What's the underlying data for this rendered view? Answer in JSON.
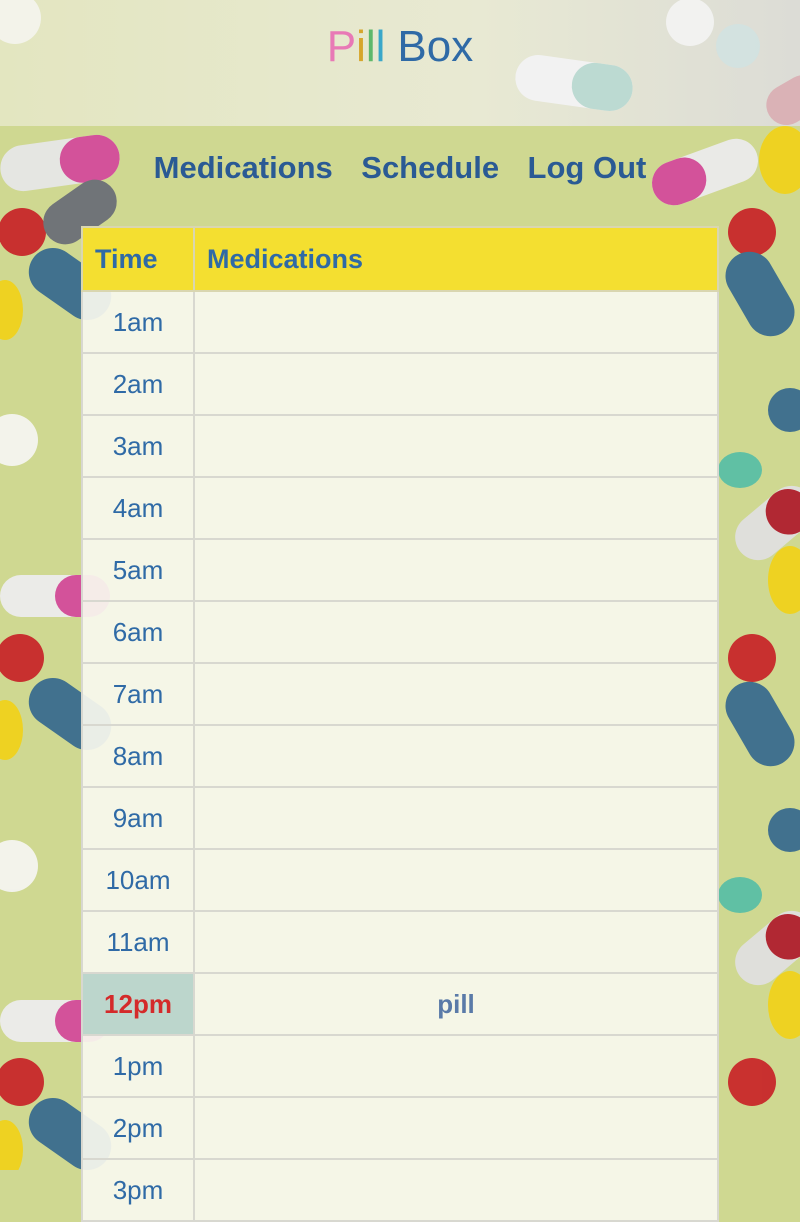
{
  "app": {
    "title_letters": [
      {
        "ch": "P",
        "color": "#e879b6"
      },
      {
        "ch": "i",
        "color": "#d6a62c"
      },
      {
        "ch": "l",
        "color": "#5fb86a"
      },
      {
        "ch": "l",
        "color": "#3aa7c9"
      },
      {
        "ch": " ",
        "color": "#2f6aa6"
      },
      {
        "ch": "B",
        "color": "#2f6aa6"
      },
      {
        "ch": "o",
        "color": "#2f6aa6"
      },
      {
        "ch": "x",
        "color": "#2f6aa6"
      }
    ]
  },
  "nav": {
    "items": [
      {
        "label": "Medications"
      },
      {
        "label": "Schedule"
      },
      {
        "label": "Log Out"
      }
    ]
  },
  "table": {
    "headers": [
      "Time",
      "Medications"
    ],
    "rows": [
      {
        "time": "1am",
        "meds": ""
      },
      {
        "time": "2am",
        "meds": ""
      },
      {
        "time": "3am",
        "meds": ""
      },
      {
        "time": "4am",
        "meds": ""
      },
      {
        "time": "5am",
        "meds": ""
      },
      {
        "time": "6am",
        "meds": ""
      },
      {
        "time": "7am",
        "meds": ""
      },
      {
        "time": "8am",
        "meds": ""
      },
      {
        "time": "9am",
        "meds": ""
      },
      {
        "time": "10am",
        "meds": ""
      },
      {
        "time": "11am",
        "meds": ""
      },
      {
        "time": "12pm",
        "meds": "pill",
        "current": true
      },
      {
        "time": "1pm",
        "meds": ""
      },
      {
        "time": "2pm",
        "meds": ""
      },
      {
        "time": "3pm",
        "meds": ""
      }
    ]
  },
  "colors": {
    "background": "#cfd891",
    "header_row": "#f4df30",
    "current_hour_bg": "#bcd6cc",
    "current_hour_text": "#d42a2a",
    "link": "#2a5a94"
  }
}
